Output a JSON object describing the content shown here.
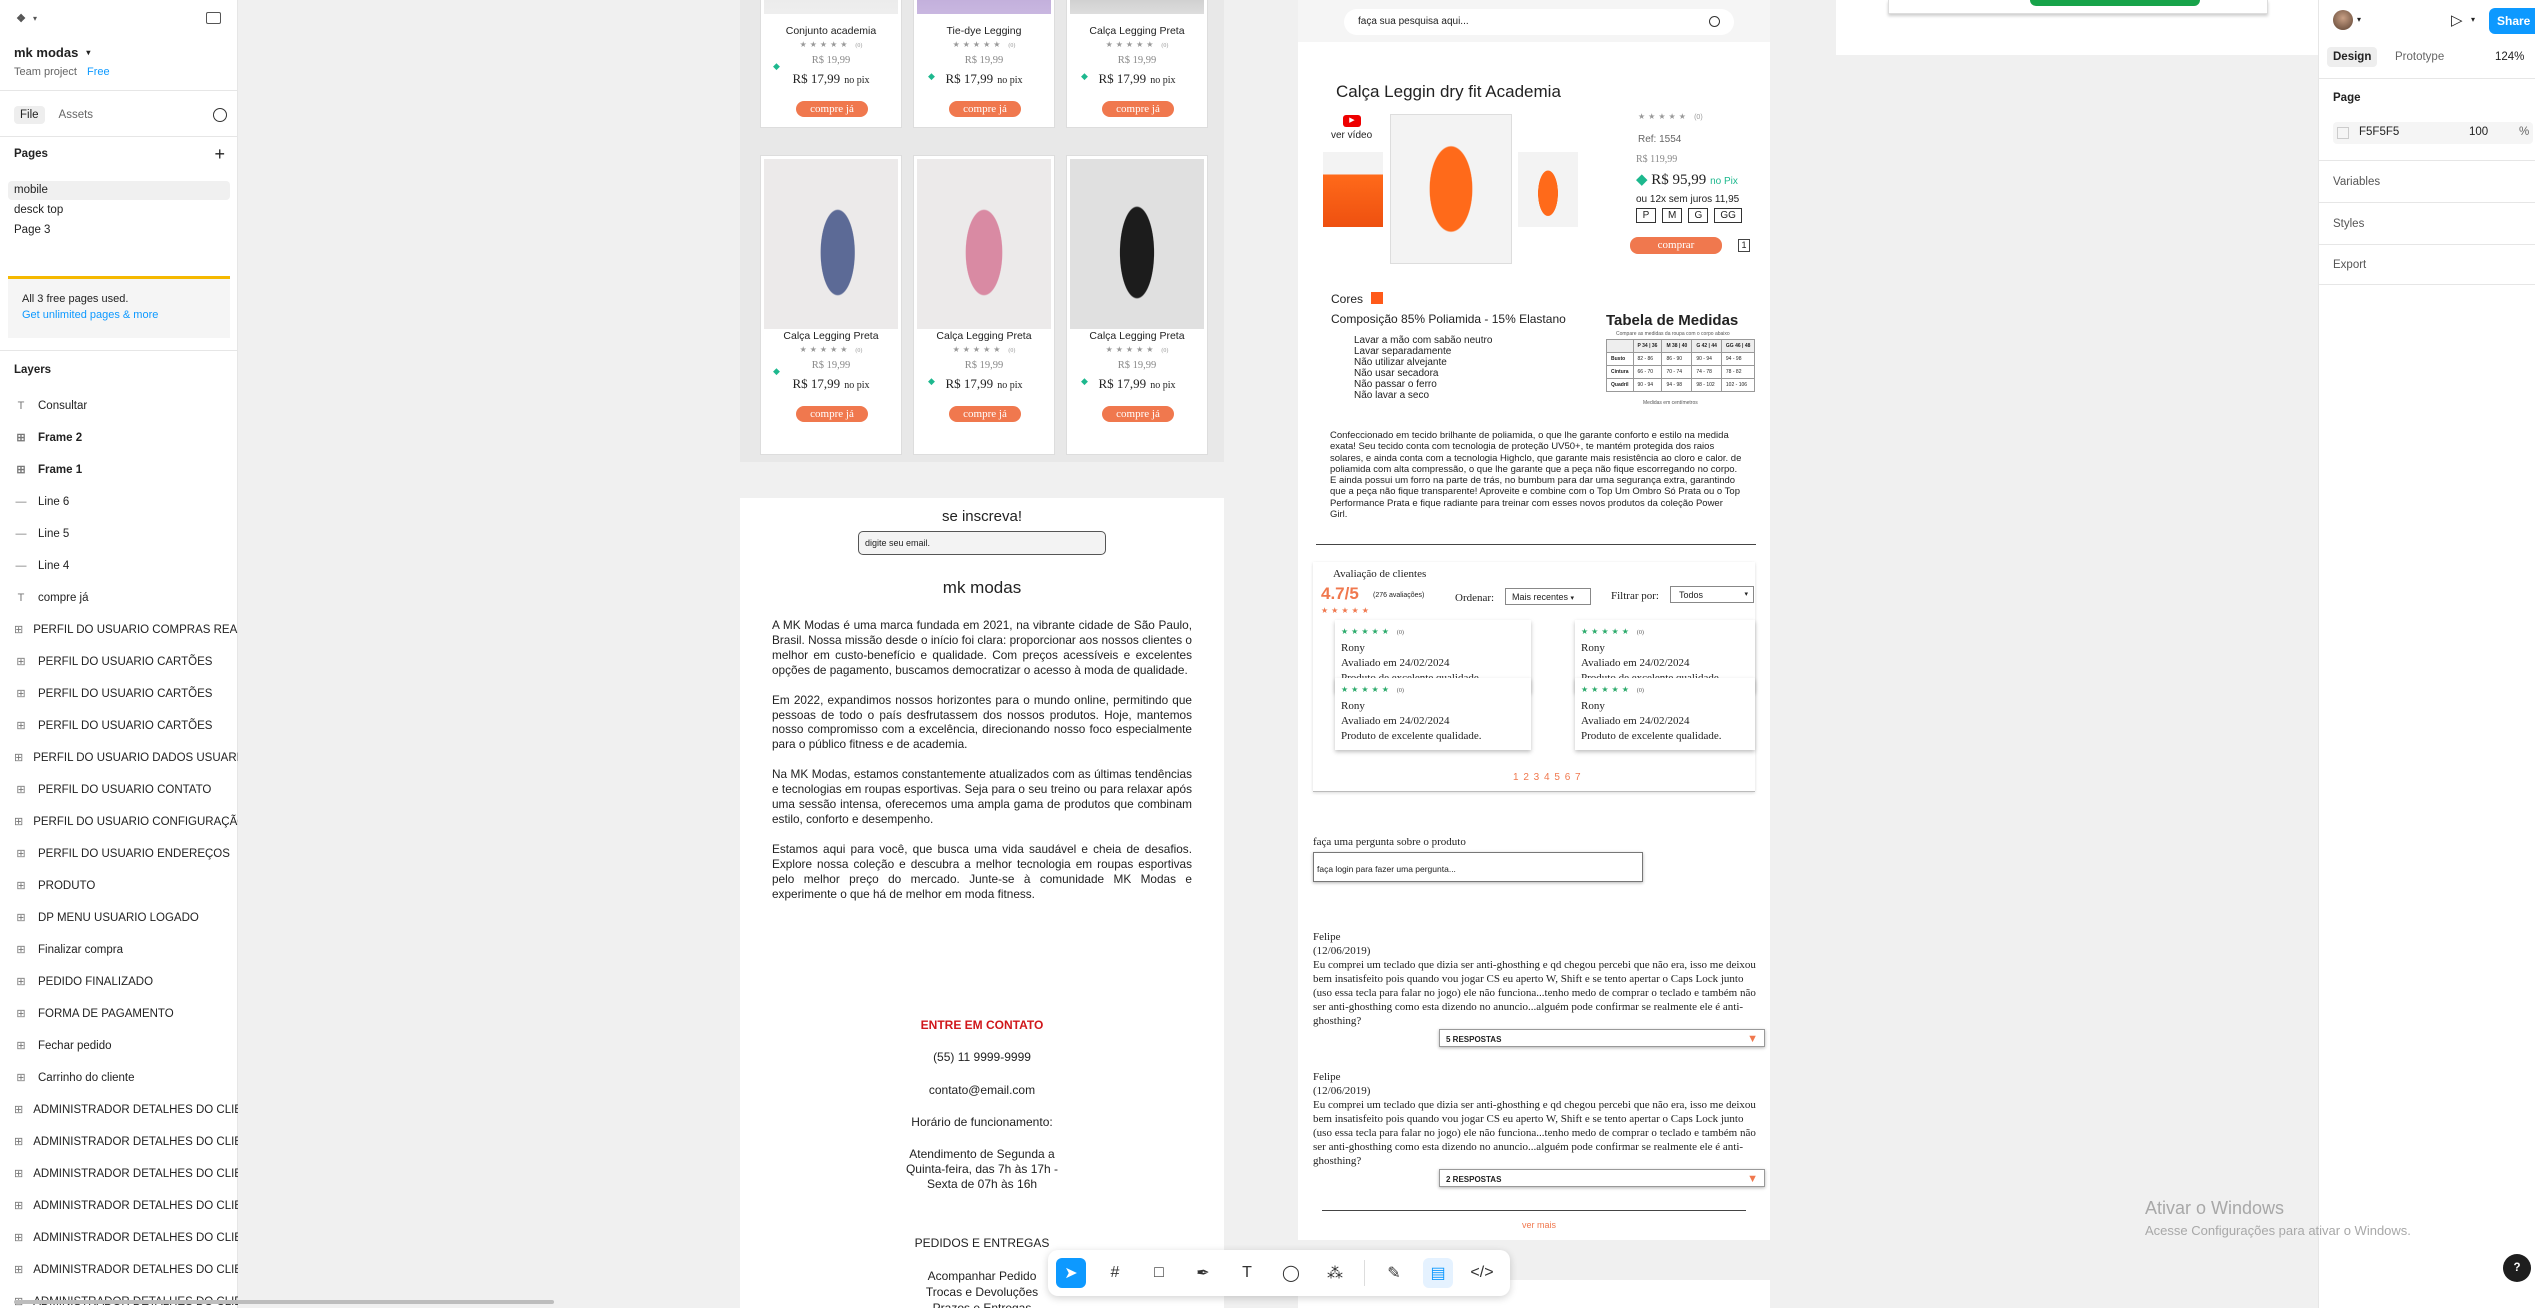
{
  "left": {
    "file_name": "mk modas",
    "team": "Team project",
    "plan": "Free",
    "tab_file": "File",
    "tab_assets": "Assets",
    "pages_title": "Pages",
    "pages": [
      "mobile",
      "desck top",
      "Page 3"
    ],
    "notice": "All 3 free pages used.",
    "notice_link": "Get unlimited pages & more",
    "layers_title": "Layers",
    "layers": [
      {
        "t": "Consultar",
        "i": "T"
      },
      {
        "t": "Frame 2",
        "i": "#"
      },
      {
        "t": "Frame 1",
        "i": "#"
      },
      {
        "t": "Line 6",
        "i": "—"
      },
      {
        "t": "Line 5",
        "i": "—"
      },
      {
        "t": "Line 4",
        "i": "—"
      },
      {
        "t": "compre já",
        "i": "T"
      },
      {
        "t": "PERFIL DO USUARIO COMPRAS REALIZADAS",
        "i": "#"
      },
      {
        "t": "PERFIL DO USUARIO CARTÕES",
        "i": "#"
      },
      {
        "t": "PERFIL DO USUARIO CARTÕES",
        "i": "#"
      },
      {
        "t": "PERFIL DO USUARIO CARTÕES",
        "i": "#"
      },
      {
        "t": "PERFIL DO USUARIO DADOS USUARIO",
        "i": "#"
      },
      {
        "t": "PERFIL DO USUARIO CONTATO",
        "i": "#"
      },
      {
        "t": "PERFIL DO USUARIO CONFIGURAÇÃO",
        "i": "#"
      },
      {
        "t": "PERFIL DO USUARIO ENDEREÇOS",
        "i": "#"
      },
      {
        "t": "PRODUTO",
        "i": "#"
      },
      {
        "t": "DP MENU USUARIO LOGADO",
        "i": "#"
      },
      {
        "t": "Finalizar compra",
        "i": "#"
      },
      {
        "t": "PEDIDO FINALIZADO",
        "i": "#"
      },
      {
        "t": "FORMA DE PAGAMENTO",
        "i": "#"
      },
      {
        "t": "Fechar pedido",
        "i": "#"
      },
      {
        "t": "Carrinho do cliente",
        "i": "#"
      },
      {
        "t": "ADMINISTRADOR DETALHES DO CLIENTE",
        "i": "#"
      },
      {
        "t": "ADMINISTRADOR DETALHES DO CLIENTE",
        "i": "#"
      },
      {
        "t": "ADMINISTRADOR DETALHES DO CLIENTE",
        "i": "#"
      },
      {
        "t": "ADMINISTRADOR DETALHES DO CLIENTE",
        "i": "#"
      },
      {
        "t": "ADMINISTRADOR DETALHES DO CLIENTE",
        "i": "#"
      },
      {
        "t": "ADMINISTRADOR DETALHES DO CLIENTE",
        "i": "#"
      },
      {
        "t": "ADMINISTRADOR DETALHES DO CLIENTE",
        "i": "#"
      }
    ]
  },
  "right": {
    "tab_design": "Design",
    "tab_prototype": "Prototype",
    "zoom": "124%",
    "share": "Share",
    "page_label": "Page",
    "page_color": "F5F5F5",
    "page_opacity": "100",
    "pct": "%",
    "variables": "Variables",
    "styles": "Styles",
    "export": "Export"
  },
  "mobile": {
    "top_cards": [
      {
        "name": "Conjunto academia",
        "old": "R$ 19,99",
        "price": "R$ 17,99",
        "pix": "no pix",
        "btn": "compre já",
        "rc": "(0)"
      },
      {
        "name": "Tie-dye Legging",
        "old": "R$ 19,99",
        "price": "R$ 17,99",
        "pix": "no pix",
        "btn": "compre já",
        "rc": "(0)"
      },
      {
        "name": "Calça Legging Preta",
        "old": "R$ 19,99",
        "price": "R$ 17,99",
        "pix": "no pix",
        "btn": "compre já",
        "rc": "(0)"
      }
    ],
    "cards": [
      {
        "name": "Calça Legging Preta",
        "old": "R$ 19,99",
        "price": "R$ 17,99",
        "pix": "no pix",
        "btn": "compre já",
        "rc": "(0)"
      },
      {
        "name": "Calça Legging Preta",
        "old": "R$ 19,99",
        "price": "R$ 17,99",
        "pix": "no pix",
        "btn": "compre já",
        "rc": "(0)"
      },
      {
        "name": "Calça Legging Preta",
        "old": "R$ 19,99",
        "price": "R$ 17,99",
        "pix": "no pix",
        "btn": "compre já",
        "rc": "(0)"
      }
    ],
    "subscribe": "se inscreva!",
    "email_ph": "digite seu email.",
    "brand": "mk modas",
    "about": [
      "A MK Modas é uma marca fundada em 2021, na vibrante cidade de São Paulo, Brasil. Nossa missão desde o início foi clara: proporcionar aos nossos clientes o melhor em custo-benefício e qualidade. Com preços acessíveis e excelentes opções de pagamento, buscamos democratizar o acesso à moda de qualidade.",
      "Em 2022, expandimos nossos horizontes para o mundo online, permitindo que pessoas de todo o país desfrutassem dos nossos produtos. Hoje, mantemos nosso compromisso com a excelência, direcionando nosso foco especialmente para o público fitness e de academia.",
      "Na MK Modas, estamos constantemente atualizados com as últimas tendências e tecnologias em roupas esportivas. Seja para o seu treino ou para relaxar após uma sessão intensa, oferecemos uma ampla gama de produtos que combinam estilo, conforto e desempenho.",
      "Estamos aqui para você, que busca uma vida saudável e cheia de desafios. Explore nossa coleção e descubra a melhor tecnologia em roupas esportivas pelo melhor preço do mercado. Junte-se à comunidade MK Modas e experimente o que há de melhor em moda fitness."
    ],
    "contact_title": "ENTRE EM CONTATO",
    "phone": "(55) 11 9999-9999",
    "email": "contato@email.com",
    "hours_title": "Horário de funcionamento:",
    "hours": "Atendimento de Segunda a Quinta-feira, das 7h às 17h - Sexta de 07h às 16h",
    "orders_title": "PEDIDOS E ENTREGAS",
    "orders_links": [
      "Acompanhar Pedido",
      "Trocas e Devoluções",
      "Prazos e Entregas"
    ]
  },
  "product": {
    "search_ph": "faça sua pesquisa aqui...",
    "title": "Calça Leggin dry fit Academia",
    "video": "ver vídeo",
    "ref": "Ref: 1554",
    "old": "R$ 119,99",
    "price": "R$ 95,99",
    "pix": "no Pix",
    "installments": "ou 12x sem juros  11,95",
    "sizes": [
      "P",
      "M",
      "G",
      "GG"
    ],
    "buy": "comprar",
    "qty": "1",
    "rating_count": "(0)",
    "colors_label": "Cores",
    "composition": "Composição 85% Poliamida - 15% Elastano",
    "care": [
      "Lavar a mão com sabão neutro",
      "Lavar separadamente",
      "Não utilizar alvejante",
      "Não usar secadora",
      "Não passar o ferro",
      "Não lavar a seco"
    ],
    "size_table_title": "Tabela de Medidas",
    "size_table_sub": "Compare as medidas da roupa com o corpo abaixo",
    "size_table_head": [
      "",
      "P 34 | 36",
      "M 38 | 40",
      "G 42 | 44",
      "GG 46 | 48"
    ],
    "size_table_rows": [
      [
        "Busto",
        "82 - 86",
        "86 - 90",
        "90 - 94",
        "94 - 98"
      ],
      [
        "Cintura",
        "66 - 70",
        "70 - 74",
        "74 - 78",
        "78 - 82"
      ],
      [
        "Quadril",
        "90 - 94",
        "94 - 98",
        "98 - 102",
        "102 - 106"
      ]
    ],
    "size_table_note": "Medidas em centímetros",
    "description": "Confeccionado em tecido brilhante de poliamida, o que lhe garante conforto e estilo na medida exata! Seu tecido conta com tecnologia de proteção UV50+, te mantém protegida dos raios solares, e ainda conta com a tecnologia Highclo, que garante mais resistência ao cloro e calor. de poliamida com alta compressão, o que lhe garante que a peça não fique escorregando no corpo. E ainda possui um forro na parte de trás, no bumbum para dar uma segurança extra, garantindo que a peça não fique transparente! Aproveite e combine com o Top Um Ombro Só Prata ou o Top Performance Prata e fique radiante para treinar com esses novos produtos da coleção Power Girl.",
    "reviews_title": "Avaliação de clientes",
    "score": "4.7/5",
    "score_count": "(276 avaliações)",
    "order_label": "Ordenar:",
    "order_value": "Mais recentes",
    "filter_label": "Filtrar por:",
    "filter_value": "Todos",
    "reviews": [
      {
        "name": "Rony",
        "date": "Avaliado em 24/02/2024",
        "text": "Produto de excelente qualidade.",
        "rc": "(0)"
      },
      {
        "name": "Rony",
        "date": "Avaliado em 24/02/2024",
        "text": "Produto de excelente qualidade.",
        "rc": "(0)"
      },
      {
        "name": "Rony",
        "date": "Avaliado em 24/02/2024",
        "text": "Produto de excelente qualidade.",
        "rc": "(0)"
      },
      {
        "name": "Rony",
        "date": "Avaliado em 24/02/2024",
        "text": "Produto de excelente qualidade.",
        "rc": "(0)"
      }
    ],
    "pagination": "1 2 3 4 5 6 7",
    "ask_title": "faça uma pergunta sobre o produto",
    "ask_ph": "faça login para fazer uma pergunta...",
    "questions": [
      {
        "user": "Felipe",
        "date": "(12/06/2019)",
        "text": "Eu comprei um teclado que dizia ser anti-ghosthing e qd chegou percebi que não era, isso me deixou bem insatisfeito pois quando vou jogar CS eu aperto W, Shift e se tento apertar o Caps Lock junto (uso essa tecla para falar no jogo) ele não funciona...tenho medo de comprar o teclado e também não ser anti-ghosthing como esta dizendo no anuncio...alguém pode confirmar se realmente ele é anti-ghosthing?",
        "answers": "5 RESPOSTAS"
      },
      {
        "user": "Felipe",
        "date": "(12/06/2019)",
        "text": "Eu comprei um teclado que dizia ser anti-ghosthing e qd chegou percebi que não era, isso me deixou bem insatisfeito pois quando vou jogar CS eu aperto W, Shift e se tento apertar o Caps Lock junto (uso essa tecla para falar no jogo) ele não funciona...tenho medo de comprar o teclado e também não ser anti-ghosthing como esta dizendo no anuncio...alguém pode confirmar se realmente ele é anti-ghosthing?",
        "answers": "2 RESPOSTAS"
      }
    ],
    "see_more": "ver mais"
  },
  "windows": {
    "title": "Ativar o Windows",
    "sub": "Acesse Configurações para ativar o Windows."
  },
  "colors": {
    "accent": "#f0784e",
    "figma_blue": "#0d99ff",
    "price_green": "#1db88e",
    "contact_red": "#d0171b"
  }
}
